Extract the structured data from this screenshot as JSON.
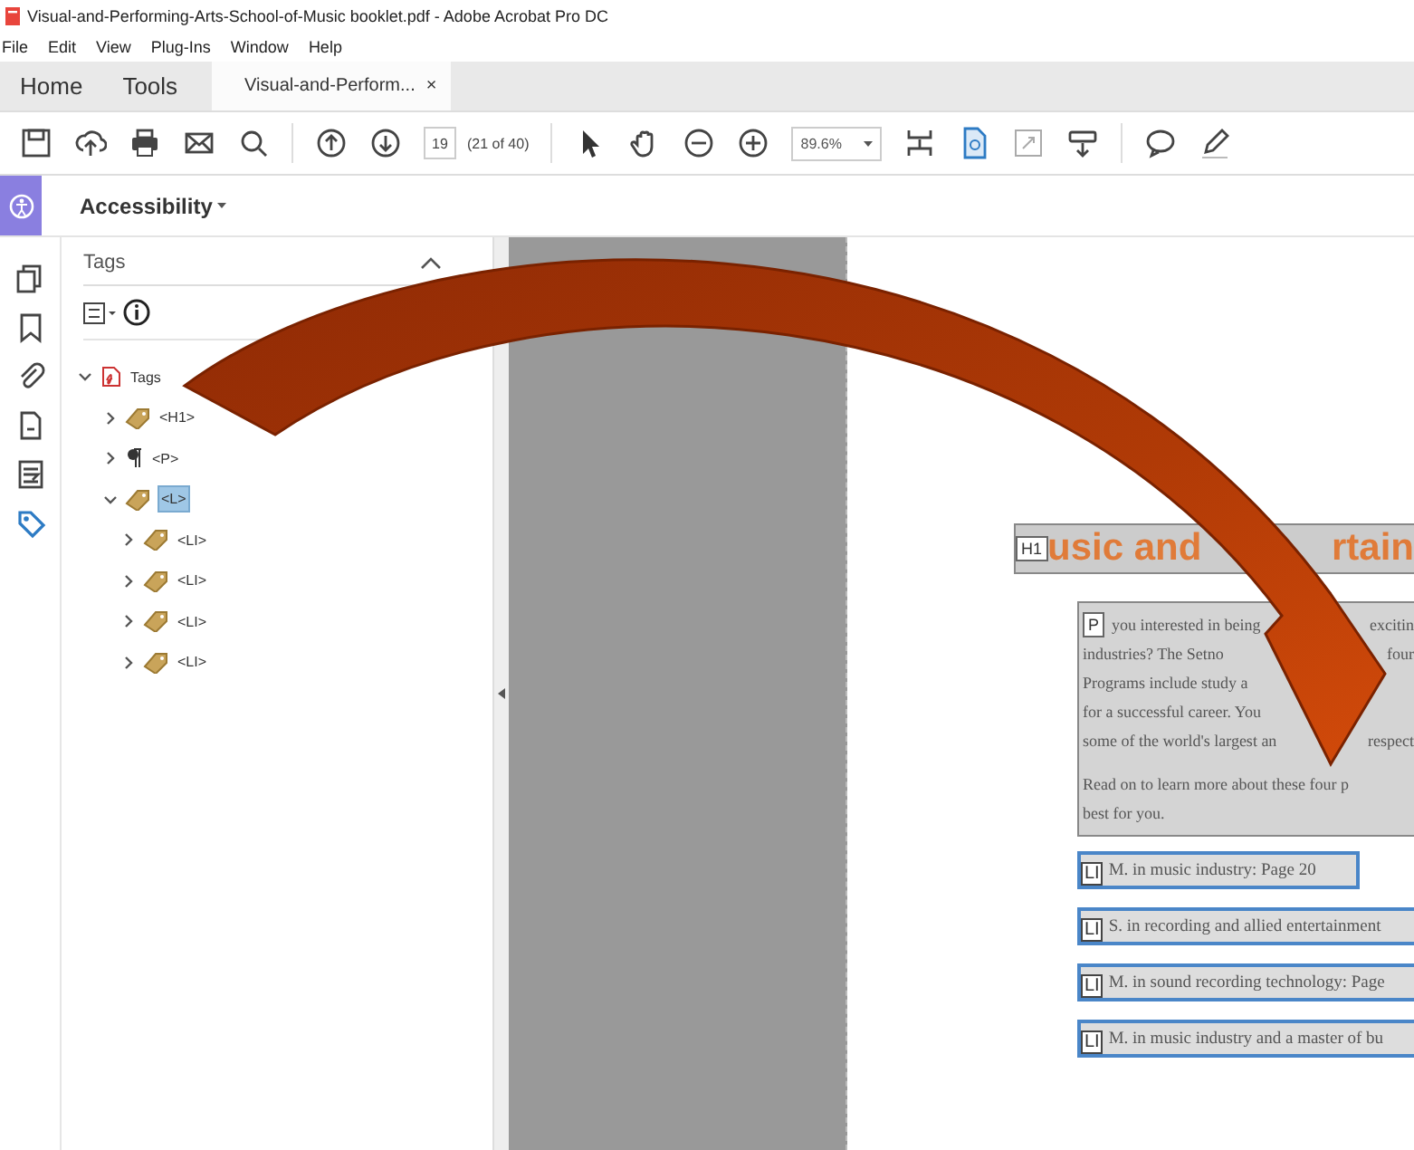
{
  "window": {
    "title": "Visual-and-Performing-Arts-School-of-Music booklet.pdf - Adobe Acrobat Pro DC"
  },
  "menu": [
    "File",
    "Edit",
    "View",
    "Plug-Ins",
    "Window",
    "Help"
  ],
  "tabs": [
    {
      "label": "Home",
      "kind": "nav",
      "selected": false
    },
    {
      "label": "Tools",
      "kind": "nav",
      "selected": false
    },
    {
      "label": "Visual-and-Perform...",
      "kind": "document",
      "close": "×",
      "selected": true
    }
  ],
  "toolbar": {
    "page": "19",
    "page_count": "(21 of 40)",
    "zoom": "89.6%"
  },
  "panel_bar": {
    "label": "Accessibility"
  },
  "side_rail": [
    {
      "kind": "pages",
      "selected": false
    },
    {
      "kind": "bookmark",
      "selected": false
    },
    {
      "kind": "attachment",
      "selected": false
    },
    {
      "kind": "document",
      "selected": false
    },
    {
      "kind": "layers",
      "selected": false
    },
    {
      "kind": "tag",
      "selected": true
    }
  ],
  "tags_panel": {
    "title": "Tags",
    "tree": [
      {
        "label": "Tags",
        "kind": "root",
        "expanded": true,
        "selected": false,
        "children": [
          {
            "label": "<H1>",
            "kind": "tag",
            "expanded": false,
            "selected": false
          },
          {
            "label": "<P>",
            "kind": "paragraph",
            "expanded": false,
            "selected": false
          },
          {
            "label": "<L>",
            "kind": "tag",
            "expanded": true,
            "selected": true,
            "children": [
              {
                "label": "<LI>",
                "kind": "tag",
                "expanded": false,
                "selected": false
              },
              {
                "label": "<LI>",
                "kind": "tag",
                "expanded": false,
                "selected": false
              },
              {
                "label": "<LI>",
                "kind": "tag",
                "expanded": false,
                "selected": false
              },
              {
                "label": "<LI>",
                "kind": "tag",
                "expanded": false,
                "selected": false
              }
            ]
          }
        ]
      }
    ]
  },
  "document": {
    "heading": {
      "tag": "H1",
      "parts": [
        "usic and",
        "rtain"
      ]
    },
    "paragraph": {
      "tag": "P",
      "lines": [
        {
          "left": "you interested in being",
          "right": "excitin"
        },
        {
          "left": "industries? The Setno",
          "right": "four"
        },
        {
          "left": "Programs include study a"
        },
        {
          "left": "for a successful career. You"
        },
        {
          "left": "some of the world's largest an",
          "right": "respect"
        },
        {
          "left": "Read on to learn more about these four p",
          "gap": true
        },
        {
          "left": "best for you."
        }
      ]
    },
    "list_items": [
      {
        "tag": "LI",
        "text": "M. in music industry: Page 20",
        "full": false
      },
      {
        "tag": "LI",
        "text": "S. in recording and allied entertainment",
        "full": true
      },
      {
        "tag": "LI",
        "text": "M. in sound recording technology: Page",
        "full": true
      },
      {
        "tag": "LI",
        "text": "M. in music industry and a master of bu",
        "full": true
      }
    ]
  }
}
